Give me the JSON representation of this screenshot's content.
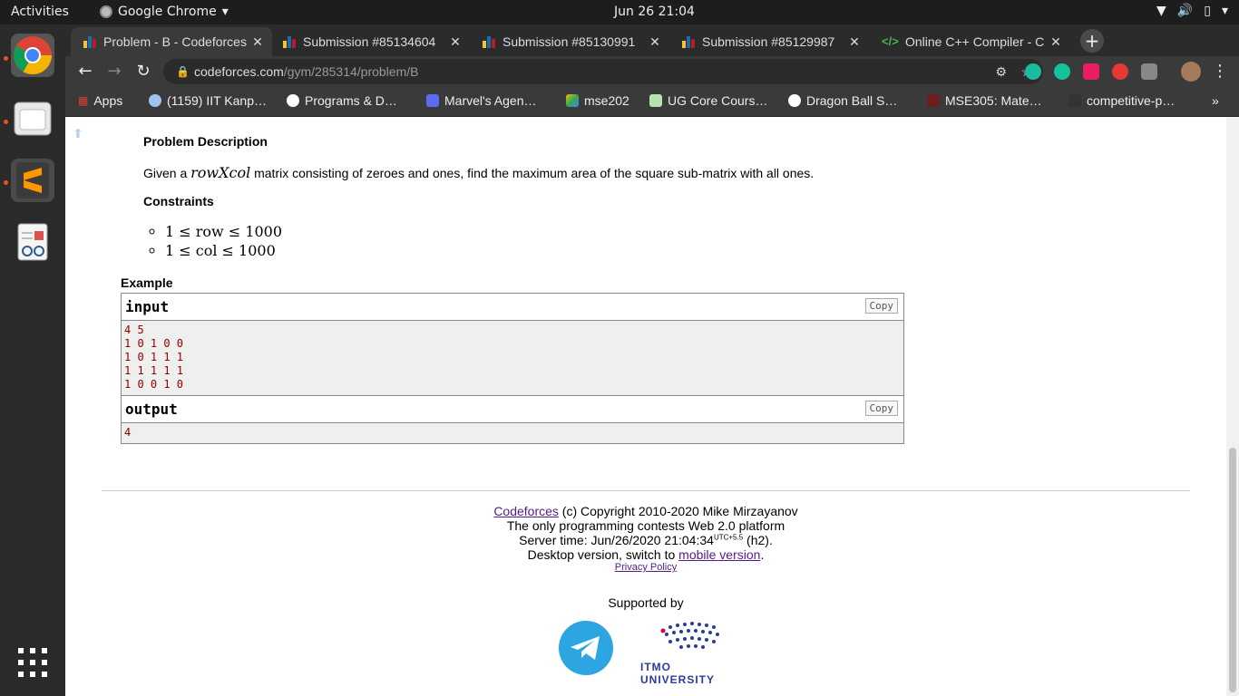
{
  "topbar": {
    "activities": "Activities",
    "app_name": "Google Chrome",
    "clock": "Jun 26  21:04"
  },
  "tabs": [
    {
      "title": "Problem - B - Codeforces",
      "active": true
    },
    {
      "title": "Submission #85134604",
      "active": false
    },
    {
      "title": "Submission #85130991",
      "active": false
    },
    {
      "title": "Submission #85129987",
      "active": false
    },
    {
      "title": "Online C++ Compiler - C",
      "active": false
    }
  ],
  "omnibox": {
    "domain": "codeforces.com",
    "path": "/gym/285314/problem/B"
  },
  "bookmarks": [
    {
      "label": "Apps"
    },
    {
      "label": "(1159) IIT Kanp…"
    },
    {
      "label": "Programs & D…"
    },
    {
      "label": "Marvel's Agen…"
    },
    {
      "label": "mse202"
    },
    {
      "label": "UG Core Cours…"
    },
    {
      "label": "Dragon Ball S…"
    },
    {
      "label": "MSE305: Mate…"
    },
    {
      "label": "competitive-p…"
    }
  ],
  "problem": {
    "description_title": "Problem Description",
    "description_prefix": "Given a ",
    "description_math": "rowXcol",
    "description_suffix": " matrix consisting of zeroes and ones, find the maximum area of the square sub-matrix with all ones.",
    "constraints_title": "Constraints",
    "constraints": [
      "1 ≤ row ≤ 1000",
      "1 ≤ col ≤ 1000"
    ],
    "example_title": "Example",
    "input_label": "input",
    "output_label": "output",
    "copy_label": "Copy",
    "input_lines": [
      "4 5",
      "1 0 1 0 0",
      "1 0 1 1 1",
      "1 1 1 1 1",
      "1 0 0 1 0"
    ],
    "output_lines": [
      "4"
    ]
  },
  "footer": {
    "codeforces_link": "Codeforces",
    "copyright": " (c) Copyright 2010-2020 Mike Mirzayanov",
    "tagline": "The only programming contests Web 2.0 platform",
    "server_time_prefix": "Server time: Jun/26/2020 21:04:34",
    "server_time_tz": "UTC+5.5",
    "server_time_suffix": " (h2).",
    "desktop_prefix": "Desktop version, switch to ",
    "mobile_link": "mobile version",
    "desktop_suffix": ".",
    "privacy": "Privacy Policy",
    "supported_by": "Supported by",
    "itmo": "ITMO UNIVERSITY"
  }
}
